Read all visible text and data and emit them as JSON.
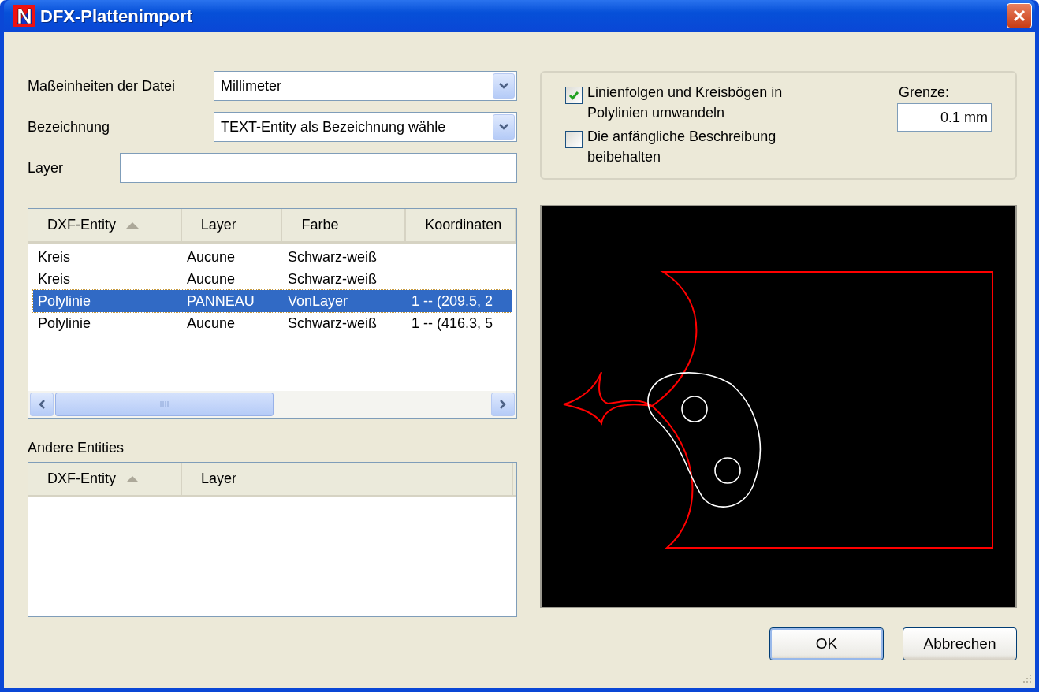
{
  "window": {
    "title": "DFX-Plattenimport"
  },
  "fields": [
    {
      "label": "Maßeinheiten der Datei",
      "value": "Millimeter",
      "kind": "dropdown"
    },
    {
      "label": "Bezeichnung",
      "value": "TEXT-Entity als Bezeichnung wähle",
      "kind": "dropdown"
    },
    {
      "label": "Layer",
      "kind": "text"
    }
  ],
  "entities_table": {
    "columns": [
      {
        "label": "DXF-Entity",
        "sorted": true
      },
      {
        "label": "Layer",
        "sorted": false
      },
      {
        "label": "Farbe",
        "sorted": false
      },
      {
        "label": "Koordinaten",
        "sorted": false
      }
    ],
    "rows": [
      {
        "cells": [
          "Kreis",
          "Aucune",
          "Schwarz-weiß"
        ],
        "selected": false
      },
      {
        "cells": [
          "Kreis",
          "Aucune",
          "Schwarz-weiß"
        ],
        "selected": false
      },
      {
        "cells": [
          "Polylinie",
          "PANNEAU",
          "VonLayer",
          "1 -- (209.5, 2"
        ],
        "selected": true
      },
      {
        "cells": [
          "Polylinie",
          "Aucune",
          "Schwarz-weiß",
          "1 -- (416.3, 5"
        ],
        "selected": false
      }
    ]
  },
  "other_entities": {
    "title": "Andere Entities",
    "columns": [
      {
        "label": "DXF-Entity",
        "sorted": true
      },
      {
        "label": "Layer",
        "sorted": false
      }
    ]
  },
  "options": [
    {
      "label": "Linienfolgen und Kreisbögen in Polylinien umwandeln",
      "checked": true
    },
    {
      "label": "Die anfängliche Beschreibung beibehalten",
      "checked": false
    }
  ],
  "limit": {
    "label": "Grenze:",
    "value": "0.1 mm"
  },
  "buttons": [
    {
      "label": "OK",
      "default": true
    },
    {
      "label": "Abbrechen",
      "default": false
    }
  ]
}
